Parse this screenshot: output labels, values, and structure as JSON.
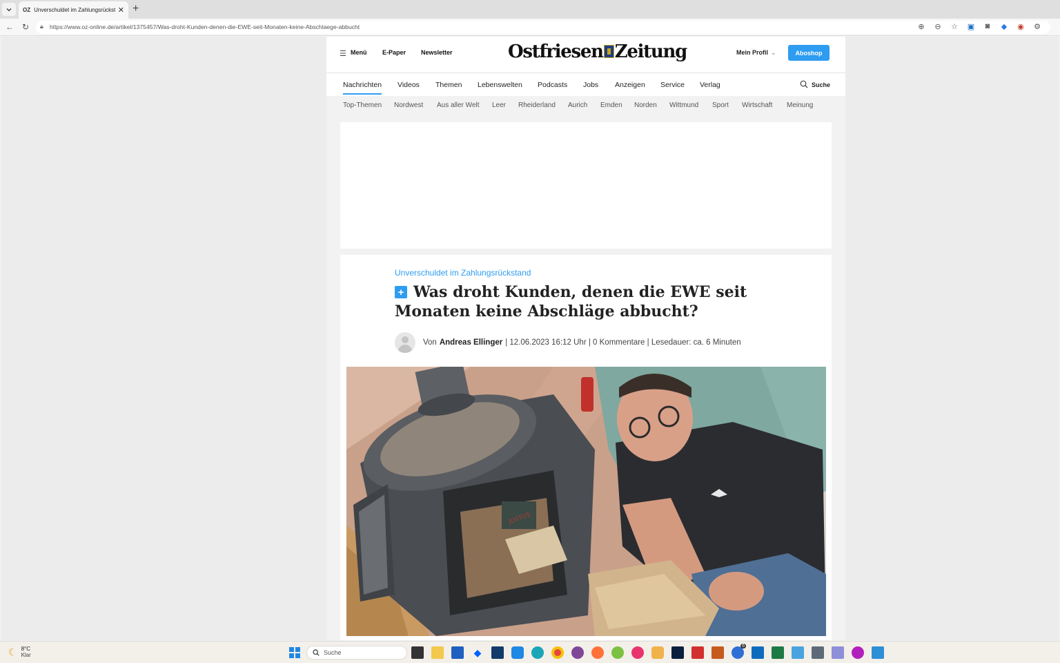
{
  "browser": {
    "tab_title": "Unverschuldet im Zahlungsrückstand",
    "favicon": "OZ",
    "url": "https://www.oz-online.de/artikel/1375457/Was-droht-Kunden-denen-die-EWE-seit-Monaten-keine-Abschlaege-abbucht"
  },
  "header": {
    "menu_label": "Menü",
    "epaper_label": "E-Paper",
    "newsletter_label": "Newsletter",
    "logo_left": "Ostfriesen",
    "logo_right": "Zeitung",
    "profile_label": "Mein Profil",
    "aboshop_label": "Aboshop"
  },
  "main_nav": {
    "items": [
      "Nachrichten",
      "Videos",
      "Themen",
      "Lebenswelten",
      "Podcasts",
      "Jobs",
      "Anzeigen",
      "Service",
      "Verlag"
    ],
    "search_label": "Suche"
  },
  "sub_nav": {
    "items": [
      "Top-Themen",
      "Nordwest",
      "Aus aller Welt",
      "Leer",
      "Rheiderland",
      "Aurich",
      "Emden",
      "Norden",
      "Wittmund",
      "Sport",
      "Wirtschaft",
      "Meinung"
    ]
  },
  "article": {
    "kicker": "Unverschuldet im Zahlungsrückstand",
    "plus_badge": "+",
    "headline": "Was droht Kunden, denen die EWE seit Monaten keine Abschläge abbucht?",
    "byline_prefix": "Von",
    "author": "Andreas Ellinger",
    "byline_meta": "| 12.06.2023 16:12 Uhr | 0 Kommentare | Lesedauer: ca. 6 Minuten"
  },
  "taskbar": {
    "weather_temp": "8°C",
    "weather_text": "Klar",
    "search_label": "Suche",
    "notification_count": "6"
  },
  "colors": {
    "accent": "#2e9cf0",
    "taskbar": "#f3efe9"
  }
}
